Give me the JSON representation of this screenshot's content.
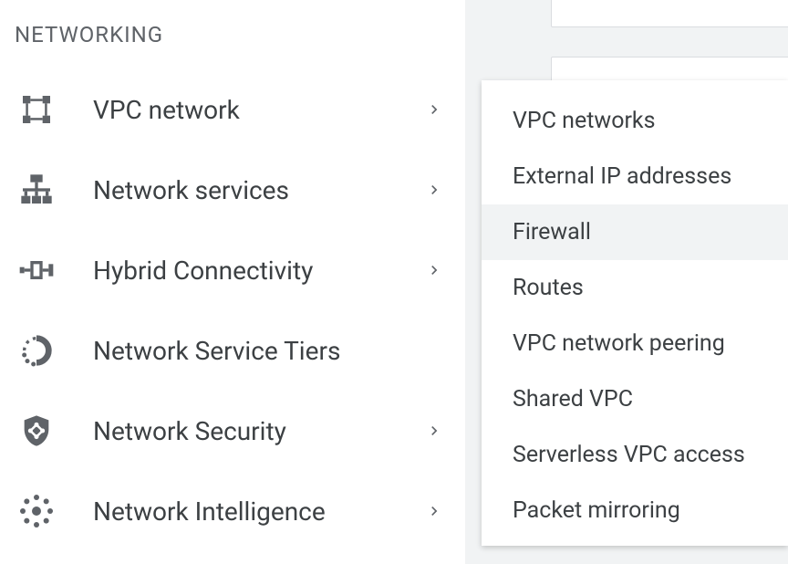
{
  "sidebar": {
    "section_header": "NETWORKING",
    "items": [
      {
        "icon": "vpc-network-icon",
        "label": "VPC network",
        "has_chevron": true
      },
      {
        "icon": "network-services-icon",
        "label": "Network services",
        "has_chevron": true
      },
      {
        "icon": "hybrid-connectivity-icon",
        "label": "Hybrid Connectivity",
        "has_chevron": true
      },
      {
        "icon": "network-service-tiers-icon",
        "label": "Network Service Tiers",
        "has_chevron": false
      },
      {
        "icon": "network-security-icon",
        "label": "Network Security",
        "has_chevron": true
      },
      {
        "icon": "network-intelligence-icon",
        "label": "Network Intelligence",
        "has_chevron": true
      }
    ]
  },
  "flyout": {
    "items": [
      {
        "label": "VPC networks",
        "highlighted": false
      },
      {
        "label": "External IP addresses",
        "highlighted": false
      },
      {
        "label": "Firewall",
        "highlighted": true
      },
      {
        "label": "Routes",
        "highlighted": false
      },
      {
        "label": "VPC network peering",
        "highlighted": false
      },
      {
        "label": "Shared VPC",
        "highlighted": false
      },
      {
        "label": "Serverless VPC access",
        "highlighted": false
      },
      {
        "label": "Packet mirroring",
        "highlighted": false
      }
    ]
  }
}
